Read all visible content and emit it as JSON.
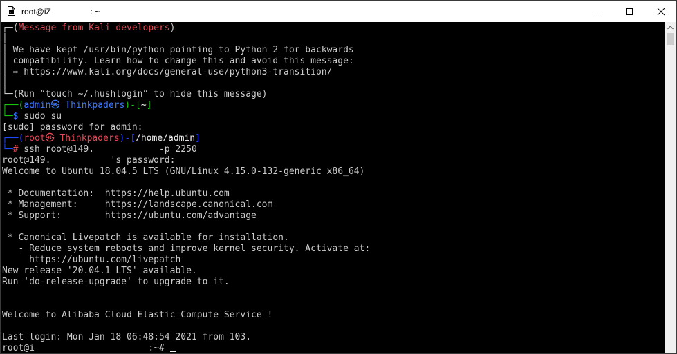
{
  "window": {
    "title": "root@iZ                 : ~"
  },
  "icons": {
    "app": "terminal-document-icon",
    "minimize": "minimize-icon",
    "maximize": "maximize-icon",
    "close": "close-icon",
    "scroll_up": "scroll-up-arrow-icon"
  },
  "colors": {
    "background": "#000000",
    "text": "#cccccc",
    "red": "#e74856",
    "blue": "#3b78ff",
    "green": "#16c60c",
    "titlebar": "#ffffff"
  },
  "terminal": {
    "line01": {
      "prefix": "┌─(",
      "msg": "Message from Kali developers",
      "suffix": ")"
    },
    "line02": "│",
    "line03": "│ We have kept /usr/bin/python pointing to Python 2 for backwards",
    "line04": "│ compatibility. Learn how to change this and avoid this message:",
    "line05": "│ ⇒ https://www.kali.org/docs/general-use/python3-transition/",
    "line06": "│",
    "line07": "└─(Run “touch ~/.hushlogin” to hide this message)",
    "line08": {
      "corner": "┌──(",
      "user": "admin㉿ Thinkpaders",
      "sep": ")-[",
      "dir": "~",
      "close": "]"
    },
    "line09": {
      "corner": "└─",
      "prompt": "$",
      "cmd": " sudo su"
    },
    "line10": "[sudo] password for admin:",
    "line11": {
      "corner": "┌──(",
      "user": "root㉿ Thinkpaders",
      "sep": ")-[",
      "dir": "/home/admin",
      "close": "]"
    },
    "line12": {
      "corner": "└─",
      "prompt": "#",
      "cmd": " ssh root@149.            -p 2250"
    },
    "line13": "root@149.           's password:",
    "line14": "Welcome to Ubuntu 18.04.5 LTS (GNU/Linux 4.15.0-132-generic x86_64)",
    "line15": "",
    "line16": " * Documentation:  https://help.ubuntu.com",
    "line17": " * Management:     https://landscape.canonical.com",
    "line18": " * Support:        https://ubuntu.com/advantage",
    "line19": "",
    "line20": " * Canonical Livepatch is available for installation.",
    "line21": "   - Reduce system reboots and improve kernel security. Activate at:",
    "line22": "     https://ubuntu.com/livepatch",
    "line23": "New release '20.04.1 LTS' available.",
    "line24": "Run 'do-release-upgrade' to upgrade to it.",
    "line25": "",
    "line26": "",
    "line27": "Welcome to Alibaba Cloud Elastic Compute Service !",
    "line28": "",
    "line29": "Last login: Mon Jan 18 06:48:54 2021 from 103.",
    "line30": "root@i                     :~# "
  }
}
